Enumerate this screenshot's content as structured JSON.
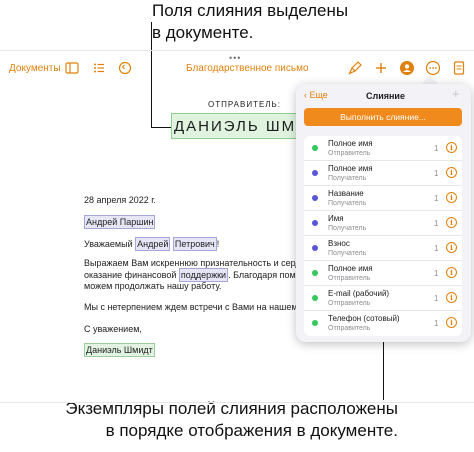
{
  "callouts": {
    "top_line1": "Поля слияния выделены",
    "top_line2": "в документе.",
    "bottom_line1": "Экземпляры полей слияния расположены",
    "bottom_line2": "в порядке отображения в документе."
  },
  "toolbar": {
    "grabber": "•••",
    "documents_label": "Документы",
    "doc_title": "Благодарственное письмо",
    "icons": [
      "sidebar-icon",
      "list-icon",
      "undo-icon",
      "brush-icon",
      "plus-icon",
      "collaborate-icon",
      "more-icon",
      "document-icon"
    ],
    "accent_color": "#e0800a"
  },
  "document": {
    "sender_label": "ОТПРАВИТЕЛЬ:",
    "sender_name": "ДАНИЭЛЬ ШМИДТ",
    "date": "28 апреля 2022 г.",
    "recipient": "Андрей Паршин",
    "greeting_prefix": "Уважаемый ",
    "greeting_first": "Андрей",
    "greeting_last": "Петрович",
    "greeting_suffix": "!",
    "para1_line1": "Выражаем Вам искреннюю признательность и сердечну",
    "para1_line2_prefix": "оказание финансовой ",
    "para1_field": "поддержки",
    "para1_line2_suffix": ". Благодаря помощи так",
    "para1_line3": "можем продолжать нашу работу.",
    "para2": "Мы с нетерпением ждем встречи с Вами на нашем следу",
    "closing": "С уважением,",
    "signature": "Даниэль Шмидт"
  },
  "panel": {
    "back_label": "Еще",
    "title": "Слияние",
    "add_symbol": "+",
    "merge_button": "Выполнить слияние...",
    "items": [
      {
        "name": "Полное имя",
        "role": "Отправитель",
        "count": "1",
        "color": "#34c759"
      },
      {
        "name": "Полное имя",
        "role": "Получатель",
        "count": "1",
        "color": "#5856d6"
      },
      {
        "name": "Название",
        "role": "Получатель",
        "count": "1",
        "color": "#5856d6"
      },
      {
        "name": "Имя",
        "role": "Получатель",
        "count": "1",
        "color": "#5856d6"
      },
      {
        "name": "Взнос",
        "role": "Получатель",
        "count": "1",
        "color": "#5856d6"
      },
      {
        "name": "Полное имя",
        "role": "Отправитель",
        "count": "1",
        "color": "#34c759"
      },
      {
        "name": "E-mail (рабочий)",
        "role": "Отправитель",
        "count": "1",
        "color": "#34c759"
      },
      {
        "name": "Телефон (сотовый)",
        "role": "Отправитель",
        "count": "1",
        "color": "#34c759"
      }
    ]
  }
}
